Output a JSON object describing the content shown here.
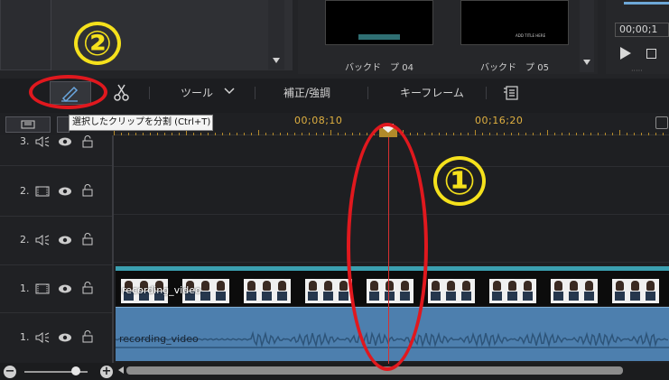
{
  "media": {
    "items": [
      {
        "label": "バックド　プ 04",
        "thumb_text": "",
        "style": "teal"
      },
      {
        "label": "バックド　プ 05",
        "thumb_text": "ADD TITLE HERE",
        "style": "white"
      }
    ]
  },
  "preview": {
    "timecode": "00;00;1"
  },
  "toolbar": {
    "tools_label": "ツール",
    "correction_label": "補正/強調",
    "keyframe_label": "キーフレーム"
  },
  "tooltip": {
    "text": "選択したクリップを分割 (Ctrl+T)"
  },
  "ruler": {
    "labels": [
      "00;08;10",
      "00;16;20"
    ]
  },
  "tracks": [
    {
      "number": "3.",
      "type": "audio"
    },
    {
      "number": "2.",
      "type": "video"
    },
    {
      "number": "2.",
      "type": "audio"
    },
    {
      "number": "1.",
      "type": "video"
    },
    {
      "number": "1.",
      "type": "audio"
    }
  ],
  "clips": {
    "video_name": "recording_video",
    "audio_name": "recording_video"
  },
  "annotations": {
    "step1": "①",
    "step2": "②"
  },
  "colors": {
    "annotation_circle": "#e0181e",
    "annotation_number": "#f5e11c",
    "playhead": "#d83030",
    "audio_clip": "#4d7fae",
    "video_clip_border": "#3b9fb0",
    "ruler_label": "#e0b040"
  }
}
